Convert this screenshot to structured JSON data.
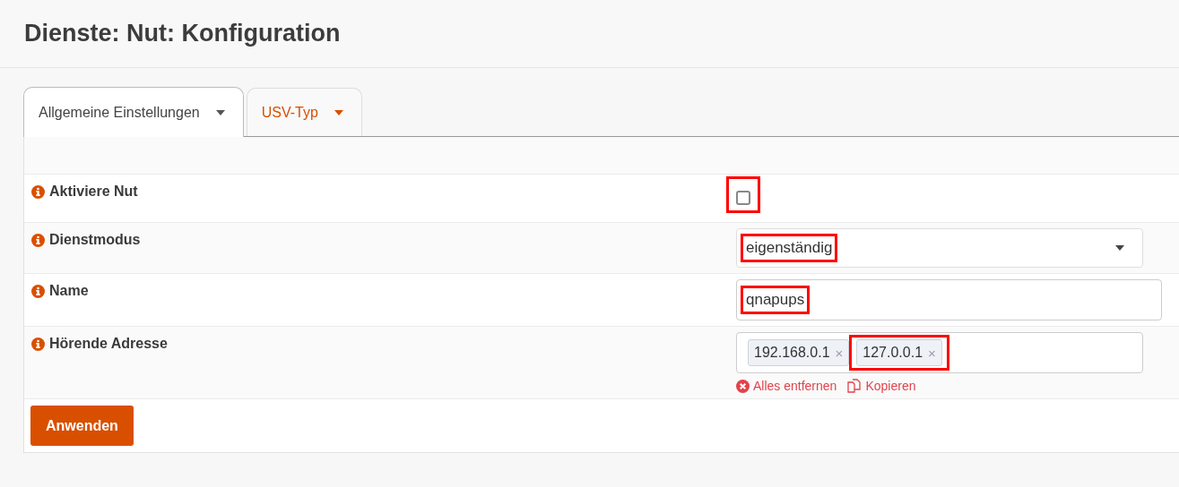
{
  "page_title": "Dienste: Nut: Konfiguration",
  "tabs": [
    {
      "label": "Allgemeine Einstellungen",
      "selected": true
    },
    {
      "label": "USV-Typ",
      "selected": false
    }
  ],
  "fields": [
    {
      "kind": "checkbox",
      "label": "Aktiviere Nut",
      "checked": false,
      "highlighted": true
    },
    {
      "kind": "select",
      "label": "Dienstmodus",
      "value": "eigenständig",
      "highlighted": true
    },
    {
      "kind": "text",
      "label": "Name",
      "value": "qnapups",
      "highlighted": true
    },
    {
      "kind": "tags",
      "label": "Hörende Adresse",
      "tags": [
        {
          "text": "192.168.0.1",
          "remove": "×",
          "highlighted": false
        },
        {
          "text": "127.0.0.1",
          "remove": "×",
          "highlighted": true
        }
      ],
      "actions": [
        {
          "kind": "clear",
          "label": "Alles entfernen"
        },
        {
          "kind": "copy",
          "label": "Kopieren"
        }
      ]
    }
  ],
  "apply_button": "Anwenden"
}
